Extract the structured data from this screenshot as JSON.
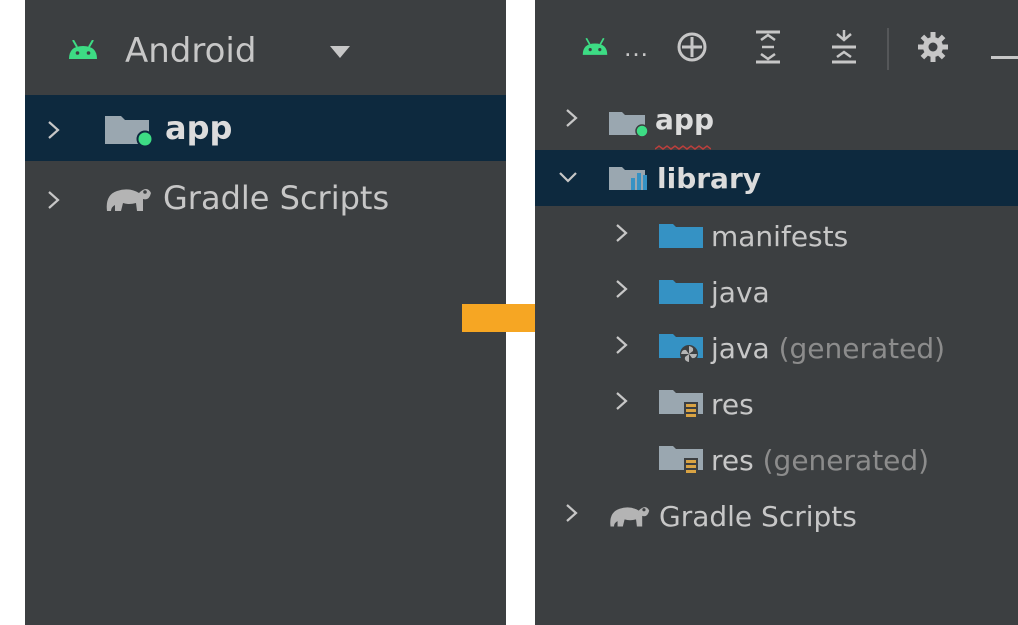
{
  "left": {
    "header": {
      "title": "Android",
      "icon": "android-icon",
      "caret": "dropdown-caret"
    },
    "tree": [
      {
        "label": "app",
        "icon": "module-folder-icon",
        "expanded": false,
        "selected": true
      },
      {
        "label": "Gradle Scripts",
        "icon": "gradle-elephant-icon",
        "expanded": false,
        "selected": false
      }
    ]
  },
  "right": {
    "toolbar": {
      "view_label": "…",
      "icons": [
        "android-icon",
        "locate-icon",
        "expand-all-icon",
        "collapse-all-icon",
        "gear-icon",
        "minimize-icon"
      ]
    },
    "tree": [
      {
        "label": "app",
        "suffix": "",
        "icon": "module-folder-icon",
        "level": 0,
        "expanded": false,
        "selected": false
      },
      {
        "label": "library",
        "suffix": "",
        "icon": "library-folder-icon",
        "level": 0,
        "expanded": true,
        "selected": true
      },
      {
        "label": "manifests",
        "suffix": "",
        "icon": "folder-icon",
        "level": 1,
        "expanded": false
      },
      {
        "label": "java",
        "suffix": "",
        "icon": "folder-icon",
        "level": 1,
        "expanded": false
      },
      {
        "label": "java",
        "suffix": "(generated)",
        "icon": "generated-folder-icon",
        "level": 1,
        "expanded": false
      },
      {
        "label": "res",
        "suffix": "",
        "icon": "res-folder-icon",
        "level": 1,
        "expanded": false
      },
      {
        "label": "res",
        "suffix": "(generated)",
        "icon": "res-folder-icon",
        "level": 1,
        "expanded": null
      },
      {
        "label": "Gradle Scripts",
        "suffix": "",
        "icon": "gradle-elephant-icon",
        "level": 0,
        "expanded": false
      }
    ]
  },
  "colors": {
    "panel_bg": "#3c3f41",
    "selection_bg": "#0d293e",
    "android_green": "#3ddc84",
    "folder_blue": "#3592c4",
    "folder_gray": "#9aa7b0",
    "arrow_orange": "#f6a623",
    "text": "#c7c7c7",
    "suffix_text": "#8c8c8c"
  }
}
